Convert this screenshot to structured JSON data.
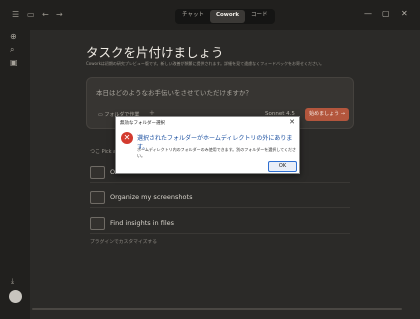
{
  "titlebar": {
    "tabs": [
      {
        "label": "チャット"
      },
      {
        "label": "Cowork"
      },
      {
        "label": "コード"
      }
    ],
    "window_controls": {
      "minimize": "—",
      "maximize": "▢",
      "close": "✕"
    }
  },
  "sidebar": {
    "icons": [
      "plus-icon",
      "search-icon",
      "briefcase-icon",
      "download-icon"
    ]
  },
  "main": {
    "title": "タスクを片付けましょう",
    "subtitle": "Coworkは初期の研究プレビュー版です。新しい改善が頻繁に提供されます。詳細を見て遠慮なくフィードバックをお寄せください。",
    "composer": {
      "placeholder": "本日はどのようなお手伝いをさせていただけますか？",
      "folder_label": "フォルダで作業",
      "add": "+",
      "model": "Sonnet 4.5",
      "send": "始めましょう →"
    },
    "pick_label": "つこ  Pick a",
    "tasks": [
      {
        "label": "O"
      },
      {
        "label": "Organize my screenshots"
      },
      {
        "label": "Find insights in files"
      }
    ],
    "customize": "プラグインでカスタマイズする"
  },
  "dialog": {
    "title": "無効なフォルダー選択",
    "close": "✕",
    "main_text": "選択されたフォルダーがホームディレクトリの外にあります。",
    "detail_text": "ホームディレクトリ内のフォルダーのみ使用できます。別のフォルダーを選択してください。",
    "ok": "OK",
    "error_glyph": "✕"
  }
}
